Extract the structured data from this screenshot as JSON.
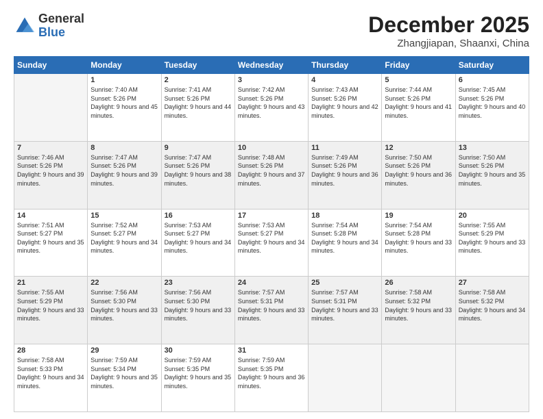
{
  "header": {
    "logo_general": "General",
    "logo_blue": "Blue",
    "month_title": "December 2025",
    "location": "Zhangjiapan, Shaanxi, China"
  },
  "days_of_week": [
    "Sunday",
    "Monday",
    "Tuesday",
    "Wednesday",
    "Thursday",
    "Friday",
    "Saturday"
  ],
  "weeks": [
    [
      {
        "day": "",
        "empty": true
      },
      {
        "day": "1",
        "sunrise": "Sunrise: 7:40 AM",
        "sunset": "Sunset: 5:26 PM",
        "daylight": "Daylight: 9 hours and 45 minutes."
      },
      {
        "day": "2",
        "sunrise": "Sunrise: 7:41 AM",
        "sunset": "Sunset: 5:26 PM",
        "daylight": "Daylight: 9 hours and 44 minutes."
      },
      {
        "day": "3",
        "sunrise": "Sunrise: 7:42 AM",
        "sunset": "Sunset: 5:26 PM",
        "daylight": "Daylight: 9 hours and 43 minutes."
      },
      {
        "day": "4",
        "sunrise": "Sunrise: 7:43 AM",
        "sunset": "Sunset: 5:26 PM",
        "daylight": "Daylight: 9 hours and 42 minutes."
      },
      {
        "day": "5",
        "sunrise": "Sunrise: 7:44 AM",
        "sunset": "Sunset: 5:26 PM",
        "daylight": "Daylight: 9 hours and 41 minutes."
      },
      {
        "day": "6",
        "sunrise": "Sunrise: 7:45 AM",
        "sunset": "Sunset: 5:26 PM",
        "daylight": "Daylight: 9 hours and 40 minutes."
      }
    ],
    [
      {
        "day": "7",
        "sunrise": "Sunrise: 7:46 AM",
        "sunset": "Sunset: 5:26 PM",
        "daylight": "Daylight: 9 hours and 39 minutes."
      },
      {
        "day": "8",
        "sunrise": "Sunrise: 7:47 AM",
        "sunset": "Sunset: 5:26 PM",
        "daylight": "Daylight: 9 hours and 39 minutes."
      },
      {
        "day": "9",
        "sunrise": "Sunrise: 7:47 AM",
        "sunset": "Sunset: 5:26 PM",
        "daylight": "Daylight: 9 hours and 38 minutes."
      },
      {
        "day": "10",
        "sunrise": "Sunrise: 7:48 AM",
        "sunset": "Sunset: 5:26 PM",
        "daylight": "Daylight: 9 hours and 37 minutes."
      },
      {
        "day": "11",
        "sunrise": "Sunrise: 7:49 AM",
        "sunset": "Sunset: 5:26 PM",
        "daylight": "Daylight: 9 hours and 36 minutes."
      },
      {
        "day": "12",
        "sunrise": "Sunrise: 7:50 AM",
        "sunset": "Sunset: 5:26 PM",
        "daylight": "Daylight: 9 hours and 36 minutes."
      },
      {
        "day": "13",
        "sunrise": "Sunrise: 7:50 AM",
        "sunset": "Sunset: 5:26 PM",
        "daylight": "Daylight: 9 hours and 35 minutes."
      }
    ],
    [
      {
        "day": "14",
        "sunrise": "Sunrise: 7:51 AM",
        "sunset": "Sunset: 5:27 PM",
        "daylight": "Daylight: 9 hours and 35 minutes."
      },
      {
        "day": "15",
        "sunrise": "Sunrise: 7:52 AM",
        "sunset": "Sunset: 5:27 PM",
        "daylight": "Daylight: 9 hours and 34 minutes."
      },
      {
        "day": "16",
        "sunrise": "Sunrise: 7:53 AM",
        "sunset": "Sunset: 5:27 PM",
        "daylight": "Daylight: 9 hours and 34 minutes."
      },
      {
        "day": "17",
        "sunrise": "Sunrise: 7:53 AM",
        "sunset": "Sunset: 5:27 PM",
        "daylight": "Daylight: 9 hours and 34 minutes."
      },
      {
        "day": "18",
        "sunrise": "Sunrise: 7:54 AM",
        "sunset": "Sunset: 5:28 PM",
        "daylight": "Daylight: 9 hours and 34 minutes."
      },
      {
        "day": "19",
        "sunrise": "Sunrise: 7:54 AM",
        "sunset": "Sunset: 5:28 PM",
        "daylight": "Daylight: 9 hours and 33 minutes."
      },
      {
        "day": "20",
        "sunrise": "Sunrise: 7:55 AM",
        "sunset": "Sunset: 5:29 PM",
        "daylight": "Daylight: 9 hours and 33 minutes."
      }
    ],
    [
      {
        "day": "21",
        "sunrise": "Sunrise: 7:55 AM",
        "sunset": "Sunset: 5:29 PM",
        "daylight": "Daylight: 9 hours and 33 minutes."
      },
      {
        "day": "22",
        "sunrise": "Sunrise: 7:56 AM",
        "sunset": "Sunset: 5:30 PM",
        "daylight": "Daylight: 9 hours and 33 minutes."
      },
      {
        "day": "23",
        "sunrise": "Sunrise: 7:56 AM",
        "sunset": "Sunset: 5:30 PM",
        "daylight": "Daylight: 9 hours and 33 minutes."
      },
      {
        "day": "24",
        "sunrise": "Sunrise: 7:57 AM",
        "sunset": "Sunset: 5:31 PM",
        "daylight": "Daylight: 9 hours and 33 minutes."
      },
      {
        "day": "25",
        "sunrise": "Sunrise: 7:57 AM",
        "sunset": "Sunset: 5:31 PM",
        "daylight": "Daylight: 9 hours and 33 minutes."
      },
      {
        "day": "26",
        "sunrise": "Sunrise: 7:58 AM",
        "sunset": "Sunset: 5:32 PM",
        "daylight": "Daylight: 9 hours and 33 minutes."
      },
      {
        "day": "27",
        "sunrise": "Sunrise: 7:58 AM",
        "sunset": "Sunset: 5:32 PM",
        "daylight": "Daylight: 9 hours and 34 minutes."
      }
    ],
    [
      {
        "day": "28",
        "sunrise": "Sunrise: 7:58 AM",
        "sunset": "Sunset: 5:33 PM",
        "daylight": "Daylight: 9 hours and 34 minutes."
      },
      {
        "day": "29",
        "sunrise": "Sunrise: 7:59 AM",
        "sunset": "Sunset: 5:34 PM",
        "daylight": "Daylight: 9 hours and 35 minutes."
      },
      {
        "day": "30",
        "sunrise": "Sunrise: 7:59 AM",
        "sunset": "Sunset: 5:35 PM",
        "daylight": "Daylight: 9 hours and 35 minutes."
      },
      {
        "day": "31",
        "sunrise": "Sunrise: 7:59 AM",
        "sunset": "Sunset: 5:35 PM",
        "daylight": "Daylight: 9 hours and 36 minutes."
      },
      {
        "day": "",
        "empty": true
      },
      {
        "day": "",
        "empty": true
      },
      {
        "day": "",
        "empty": true
      }
    ]
  ]
}
